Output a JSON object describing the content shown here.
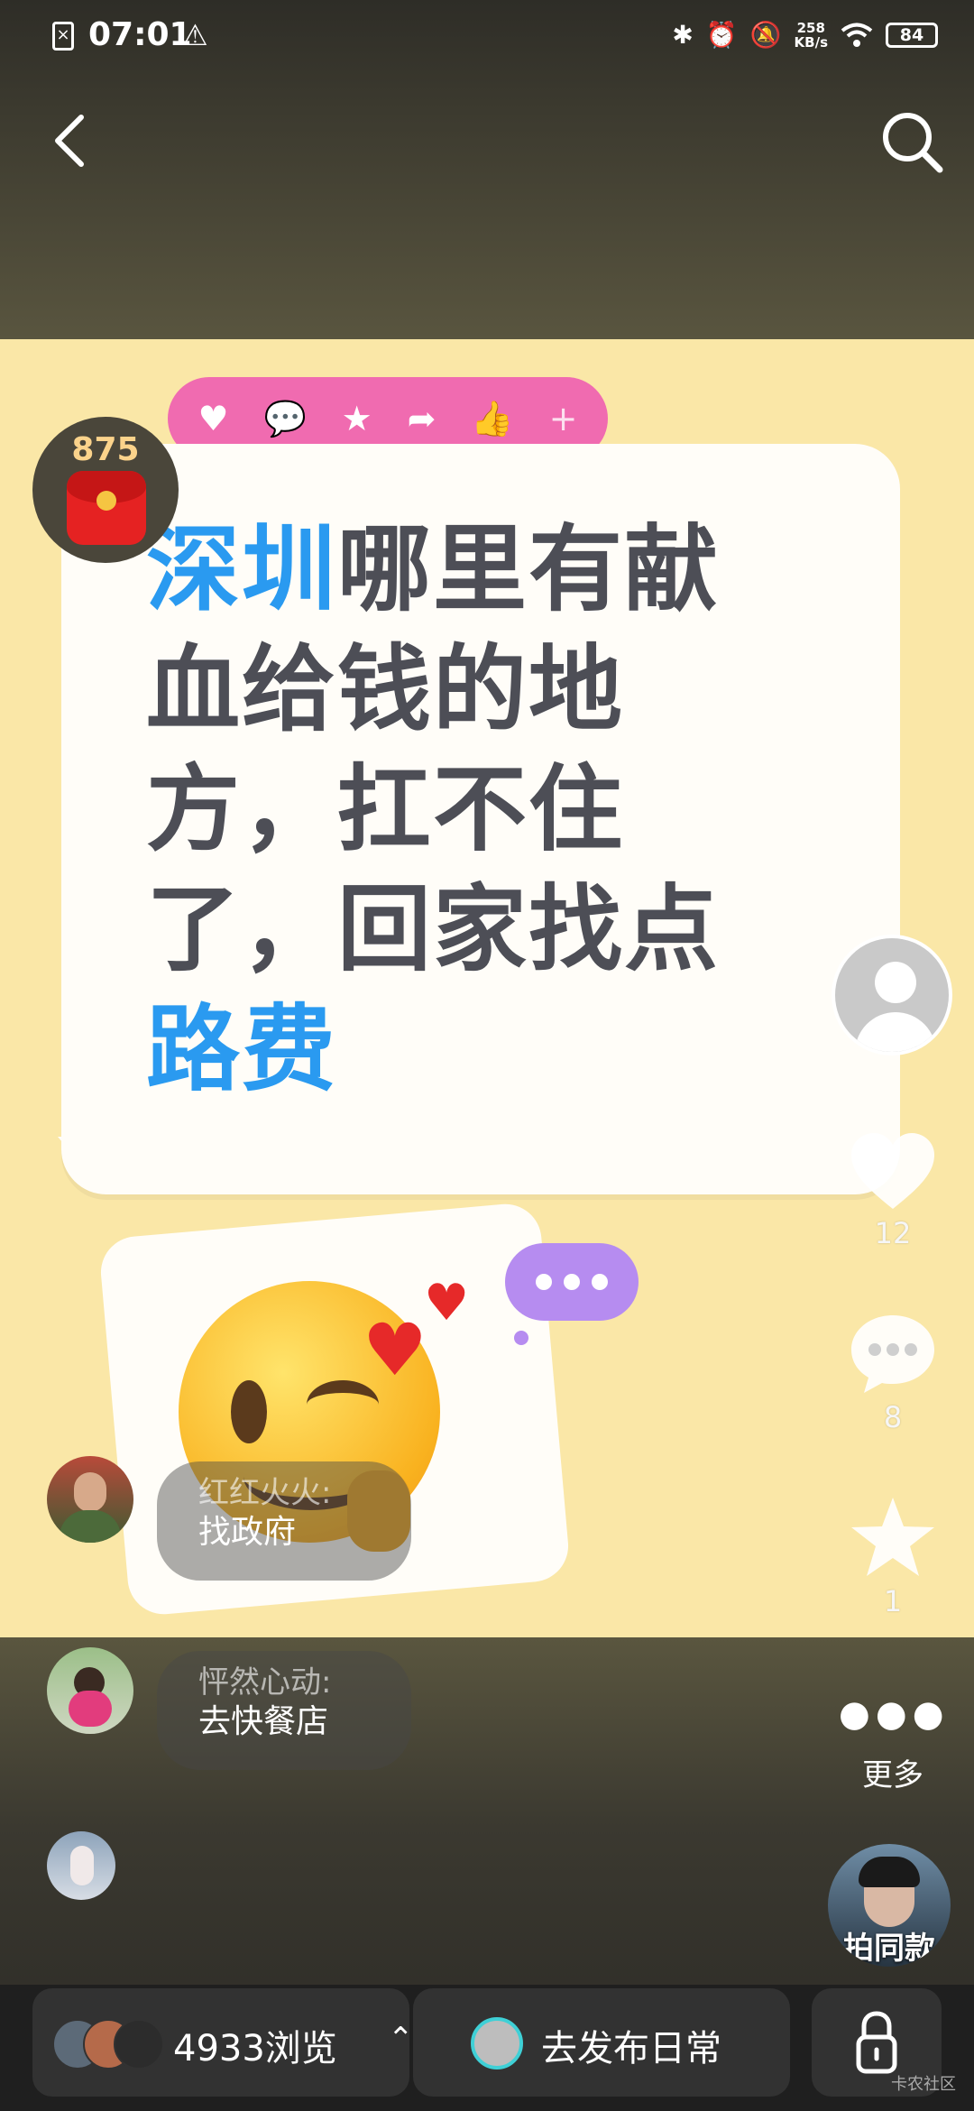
{
  "status_bar": {
    "time": "07:01",
    "net_speed_value": "258",
    "net_speed_unit": "KB/s",
    "battery": "84"
  },
  "poster": {
    "redpacket_count": "875",
    "lines": [
      {
        "blue": "深圳",
        "dark": "哪里有献"
      },
      {
        "blue": "",
        "dark": "血给钱的地"
      },
      {
        "blue": "",
        "dark": "方，扛不住"
      },
      {
        "blue": "",
        "dark": "了，回家找点"
      },
      {
        "blue": "路费",
        "dark": ""
      }
    ]
  },
  "rail": {
    "like_count": "12",
    "comment_count": "8",
    "favorite_count": "1",
    "more_label": "更多",
    "same_style_label": "拍同款"
  },
  "comments": [
    {
      "name": "红红火火:",
      "text": "找政府"
    },
    {
      "name": "怦然心动:",
      "text": "去快餐店"
    }
  ],
  "bottom_bar": {
    "views": "4933浏览",
    "publish": "去发布日常"
  },
  "watermark": "卡农社区",
  "colors": {
    "poster_bg": "#fae7a7",
    "headline_blue": "#2a9af0",
    "headline_dark": "#4d4e56",
    "reaction_pink": "#f06bb0",
    "chat_purple": "#b68cf0"
  }
}
